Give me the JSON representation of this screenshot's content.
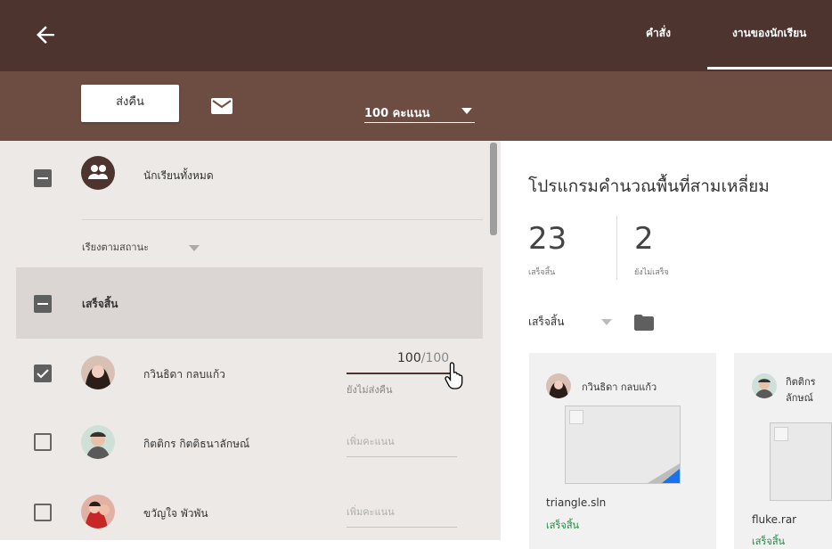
{
  "header": {
    "back_icon": "arrow-left-icon",
    "tabs": [
      {
        "label": "คำสั่ง"
      },
      {
        "label": "งานของนักเรียน"
      }
    ]
  },
  "toolbar": {
    "return_label": "ส่งคืน",
    "mail_icon": "envelope-icon",
    "points_value": "100 คะแนน"
  },
  "students_panel": {
    "all_students_label": "นักเรียนทั้งหมด",
    "sort_label": "เรียงตามสถานะ",
    "group_label": "เสร็จสิ้น",
    "rows": [
      {
        "name": "กวินธิดา กลบแก้ว",
        "score": "100",
        "total": "/100",
        "status": "ยังไม่ส่งคืน",
        "checked": true
      },
      {
        "name": "กิตติกร กิตติธนาลักษณ์",
        "score_placeholder": "เพิ่มคะแนน",
        "checked": false
      },
      {
        "name": "ขวัญใจ พัวพัน",
        "score_placeholder": "เพิ่มคะแนน",
        "checked": false
      }
    ]
  },
  "assignment": {
    "title": "โปรแกรมคำนวณพื้นที่สามเหลี่ยม",
    "done_count": "23",
    "done_label": "เสร็จสิ้น",
    "not_done_count": "2",
    "not_done_label": "ยังไม่เสร็จ",
    "filter_label": "เสร็จสิ้น",
    "folder_icon": "folder-icon",
    "cards": [
      {
        "student": "กวินธิดา กลบแก้ว",
        "file": "triangle.sln",
        "status": "เสร็จสิ้น"
      },
      {
        "student_line1": "กิตติกร",
        "student_line2": "ลักษณ์",
        "file": "fluke.rar",
        "status": "เสร็จสิ้น"
      }
    ]
  }
}
